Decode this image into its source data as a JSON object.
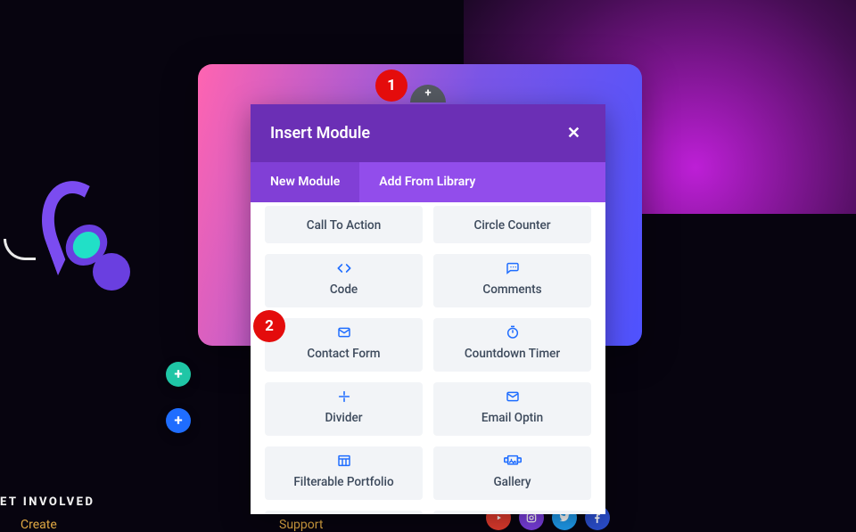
{
  "modal": {
    "title": "Insert Module",
    "tabs": {
      "new": "New Module",
      "library": "Add From Library"
    },
    "modules": [
      {
        "label": "Call To Action",
        "icon": "cta"
      },
      {
        "label": "Circle Counter",
        "icon": "circle"
      },
      {
        "label": "Code",
        "icon": "code"
      },
      {
        "label": "Comments",
        "icon": "comment"
      },
      {
        "label": "Contact Form",
        "icon": "mail"
      },
      {
        "label": "Countdown Timer",
        "icon": "timer"
      },
      {
        "label": "Divider",
        "icon": "divider"
      },
      {
        "label": "Email Optin",
        "icon": "mail"
      },
      {
        "label": "Filterable Portfolio",
        "icon": "grid"
      },
      {
        "label": "Gallery",
        "icon": "image-row"
      },
      {
        "label": "",
        "icon": "dot-circle"
      },
      {
        "label": "",
        "icon": "image"
      }
    ]
  },
  "callouts": {
    "one": "1",
    "two": "2"
  },
  "footer": {
    "heading": "ET INVOLVED",
    "link_create": "Create",
    "link_support": "Support"
  },
  "add": {
    "plus": "+"
  }
}
